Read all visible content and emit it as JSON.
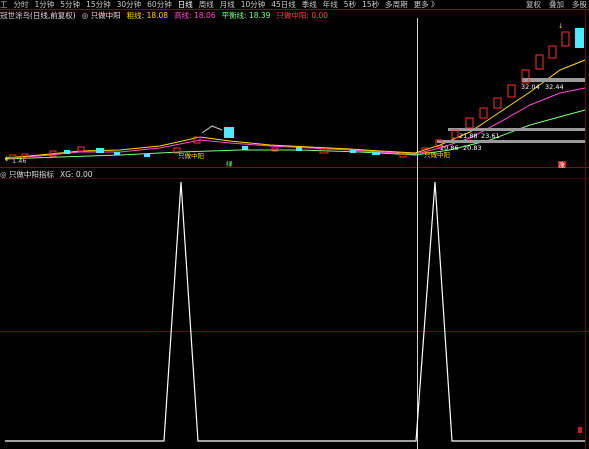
{
  "toolbar": {
    "lead": "工",
    "periods": [
      "分时",
      "1分钟",
      "5分钟",
      "15分钟",
      "30分钟",
      "60分钟",
      "日线",
      "周线",
      "月线",
      "10分钟",
      "45日线",
      "季线",
      "年线",
      "5秒",
      "15秒",
      "多周期",
      "更多 》"
    ],
    "right": [
      "复权",
      "叠加",
      "多股"
    ]
  },
  "main_panel": {
    "title": "冠世涂鸟(日线,前复权)",
    "indicator": "只做中阳",
    "rows": [
      {
        "label": "粗线",
        "value": "18.08",
        "color": "#ffd800"
      },
      {
        "label": "高线",
        "value": "18.06",
        "color": "#ff4ad6"
      },
      {
        "label": "平衡线",
        "value": "18.39",
        "color": "#7cff7c"
      },
      {
        "label": "只做中阳",
        "value": "0.00",
        "color": "#ff4040"
      }
    ]
  },
  "annotations": {
    "price_low_left": "1.46",
    "label_mid": "只做中阳",
    "label_green_left": "绿",
    "label_green_right": "只做中阳",
    "level1_a": "32.04",
    "level1_b": "32.44",
    "level2_a": "21.88",
    "level2_b": "23.61",
    "level3_a": "20.86",
    "level3_b": "20.83",
    "red_tag": "涨"
  },
  "sub_panel": {
    "title": "只做中阳指标",
    "xg_label": "XG",
    "xg_value": "0.00"
  },
  "colors": {
    "background": "#000000",
    "up": "#ff3030",
    "down": "#50e8ff",
    "ma_yellow": "#ffd800",
    "ma_pink": "#ff4ad6",
    "ma_green": "#7cff7c",
    "crosshair": "#d0d0d0",
    "signal": "#ffffff"
  }
}
